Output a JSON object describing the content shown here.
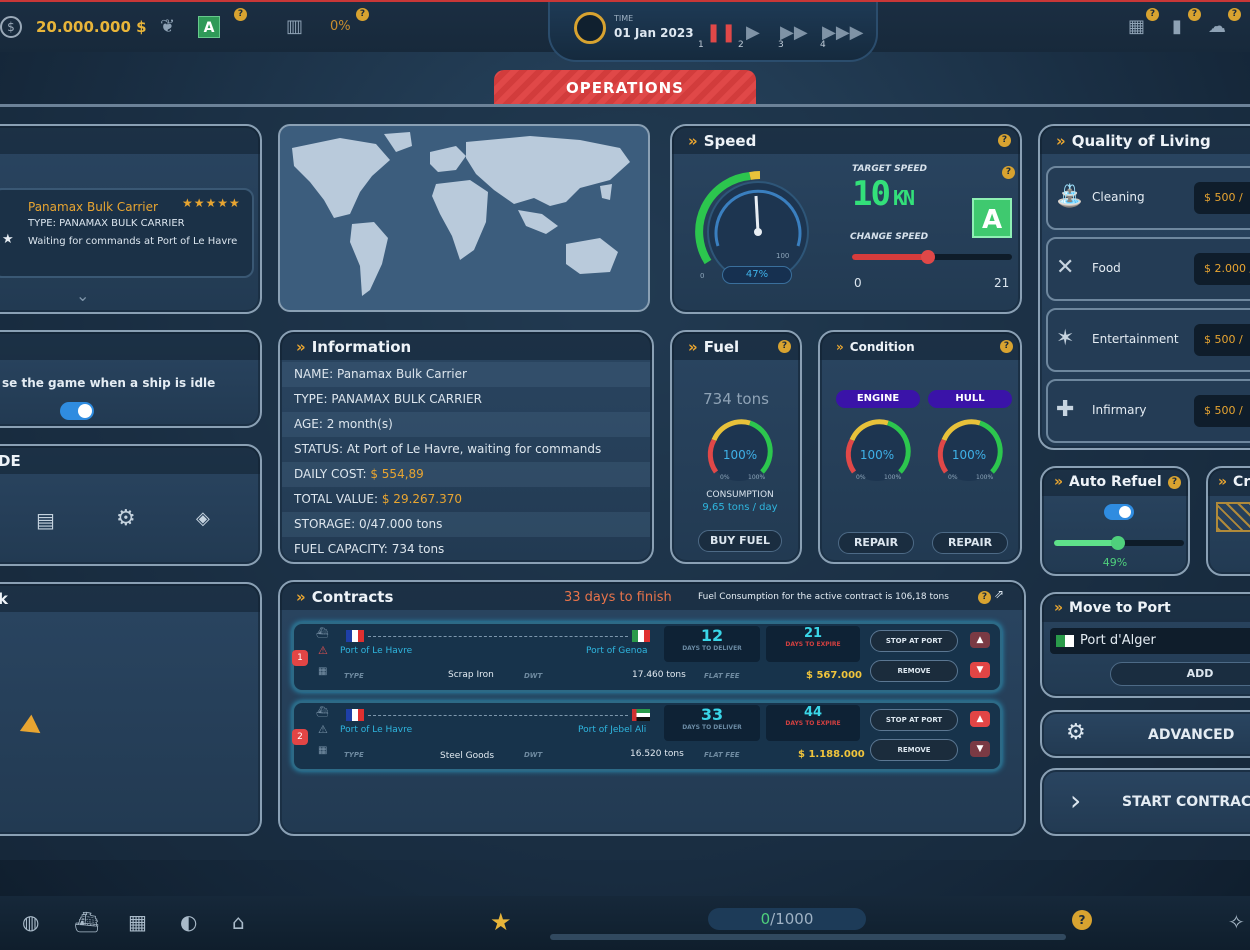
{
  "topbar": {
    "money": "20.000.000 $",
    "grade": "A",
    "percent": "0%",
    "time_label": "TIME",
    "date": "01 Jan 2023",
    "speeds": [
      "1",
      "2",
      "3",
      "4"
    ]
  },
  "tab_title": "OPERATIONS",
  "ship_card": {
    "name": "Panamax Bulk Carrier",
    "stars": "★★★★★",
    "type": "TYPE: PANAMAX BULK CARRIER",
    "status": "Waiting for commands at Port of Le Havre"
  },
  "idle_panel": {
    "text": "se the game when a ship is idle"
  },
  "mode_panel": {
    "title": "DE"
  },
  "left_bottom_panel": {
    "title": "k"
  },
  "information": {
    "title": "Information",
    "rows": [
      {
        "label": "NAME:",
        "value": "Panamax Bulk Carrier",
        "highlight": ""
      },
      {
        "label": "TYPE:",
        "value": "PANAMAX BULK CARRIER",
        "highlight": ""
      },
      {
        "label": "AGE:",
        "value": "2 month(s)",
        "highlight": ""
      },
      {
        "label": "STATUS:",
        "value": "At Port of Le Havre, waiting for commands",
        "highlight": ""
      },
      {
        "label": "DAILY COST:",
        "value": "",
        "highlight": "$ 554,89"
      },
      {
        "label": "TOTAL VALUE:",
        "value": "",
        "highlight": "$ 29.267.370"
      },
      {
        "label": "STORAGE:",
        "value": "0/47.000 tons",
        "highlight": ""
      },
      {
        "label": "FUEL CAPACITY:",
        "value": "734 tons",
        "highlight": ""
      }
    ]
  },
  "speed": {
    "title": "Speed",
    "gauge_percent": "47%",
    "gauge_fraction": 0.47,
    "gauge_min": "0",
    "gauge_max": "100",
    "target_label": "TARGET SPEED",
    "target_value": "10",
    "target_unit": "KN",
    "grade": "A",
    "change_label": "CHANGE SPEED",
    "slider_min": "0",
    "slider_max": "21",
    "slider_value": 10
  },
  "fuel": {
    "title": "Fuel",
    "amount": "734 tons",
    "gauge": "100%",
    "gauge_min": "0%",
    "gauge_max": "100%",
    "consumption_label": "CONSUMPTION",
    "consumption_value": "9,65 tons / day",
    "buy_label": "BUY FUEL"
  },
  "condition": {
    "title": "Condition",
    "engine_label": "ENGINE",
    "hull_label": "HULL",
    "engine_value": "100%",
    "hull_value": "100%",
    "gauge_min": "0%",
    "gauge_max": "100%",
    "repair_label": "REPAIR"
  },
  "contracts": {
    "title": "Contracts",
    "days_to_finish": "33 days to finish",
    "fuel_note": "Fuel Consumption for the active contract is 106,18 tons",
    "days_to_deliver_label": "DAYS TO DELIVER",
    "days_to_expire_label": "DAYS TO EXPIRE",
    "type_label": "TYPE",
    "dwt_label": "DWT",
    "flat_fee_label": "FLAT FEE",
    "stop_label": "STOP AT PORT",
    "remove_label": "REMOVE",
    "items": [
      {
        "index": "1",
        "from": "Port of Le Havre",
        "to": "Port of Genoa",
        "days_deliver": "12",
        "days_expire": "21",
        "type": "Scrap Iron",
        "dwt": "17.460 tons",
        "fee": "$ 567.000",
        "arrow_active": "down"
      },
      {
        "index": "2",
        "from": "Port of Le Havre",
        "to": "Port of Jebel Ali",
        "days_deliver": "33",
        "days_expire": "44",
        "type": "Steel Goods",
        "dwt": "16.520 tons",
        "fee": "$ 1.188.000",
        "arrow_active": "up"
      }
    ]
  },
  "quality_of_living": {
    "title": "Quality of Living",
    "items": [
      {
        "label": "Cleaning",
        "value": "$ 500 /"
      },
      {
        "label": "Food",
        "value": "$ 2.000 /"
      },
      {
        "label": "Entertainment",
        "value": "$ 500 /"
      },
      {
        "label": "Infirmary",
        "value": "$ 500 /"
      }
    ]
  },
  "auto_refuel": {
    "title": "Auto Refuel",
    "value": "49%",
    "fraction": 0.49
  },
  "crew_panel": {
    "title": "Cr"
  },
  "move_to_port": {
    "title": "Move to Port",
    "selected": "Port d'Alger",
    "add_label": "ADD"
  },
  "advanced_label": "ADVANCED",
  "start_label": "START CONTRAC",
  "bottombar": {
    "progress": "0/1000",
    "progress_current": "0",
    "progress_total": "/1000"
  },
  "colors": {
    "accent_orange": "#e8a531",
    "accent_red": "#e04848",
    "green": "#33e07a",
    "cyan": "#3ad6e8",
    "panel": "#2a4561"
  },
  "icons": [
    "dollar-icon",
    "leaf-icon",
    "chart-icon",
    "clock-icon",
    "pause-icon",
    "play-icon",
    "fast-forward-icon",
    "building-icon",
    "fuel-pump-icon",
    "weather-icon",
    "gear-icon",
    "globe-icon",
    "ship-icon",
    "bank-icon",
    "star-icon"
  ]
}
